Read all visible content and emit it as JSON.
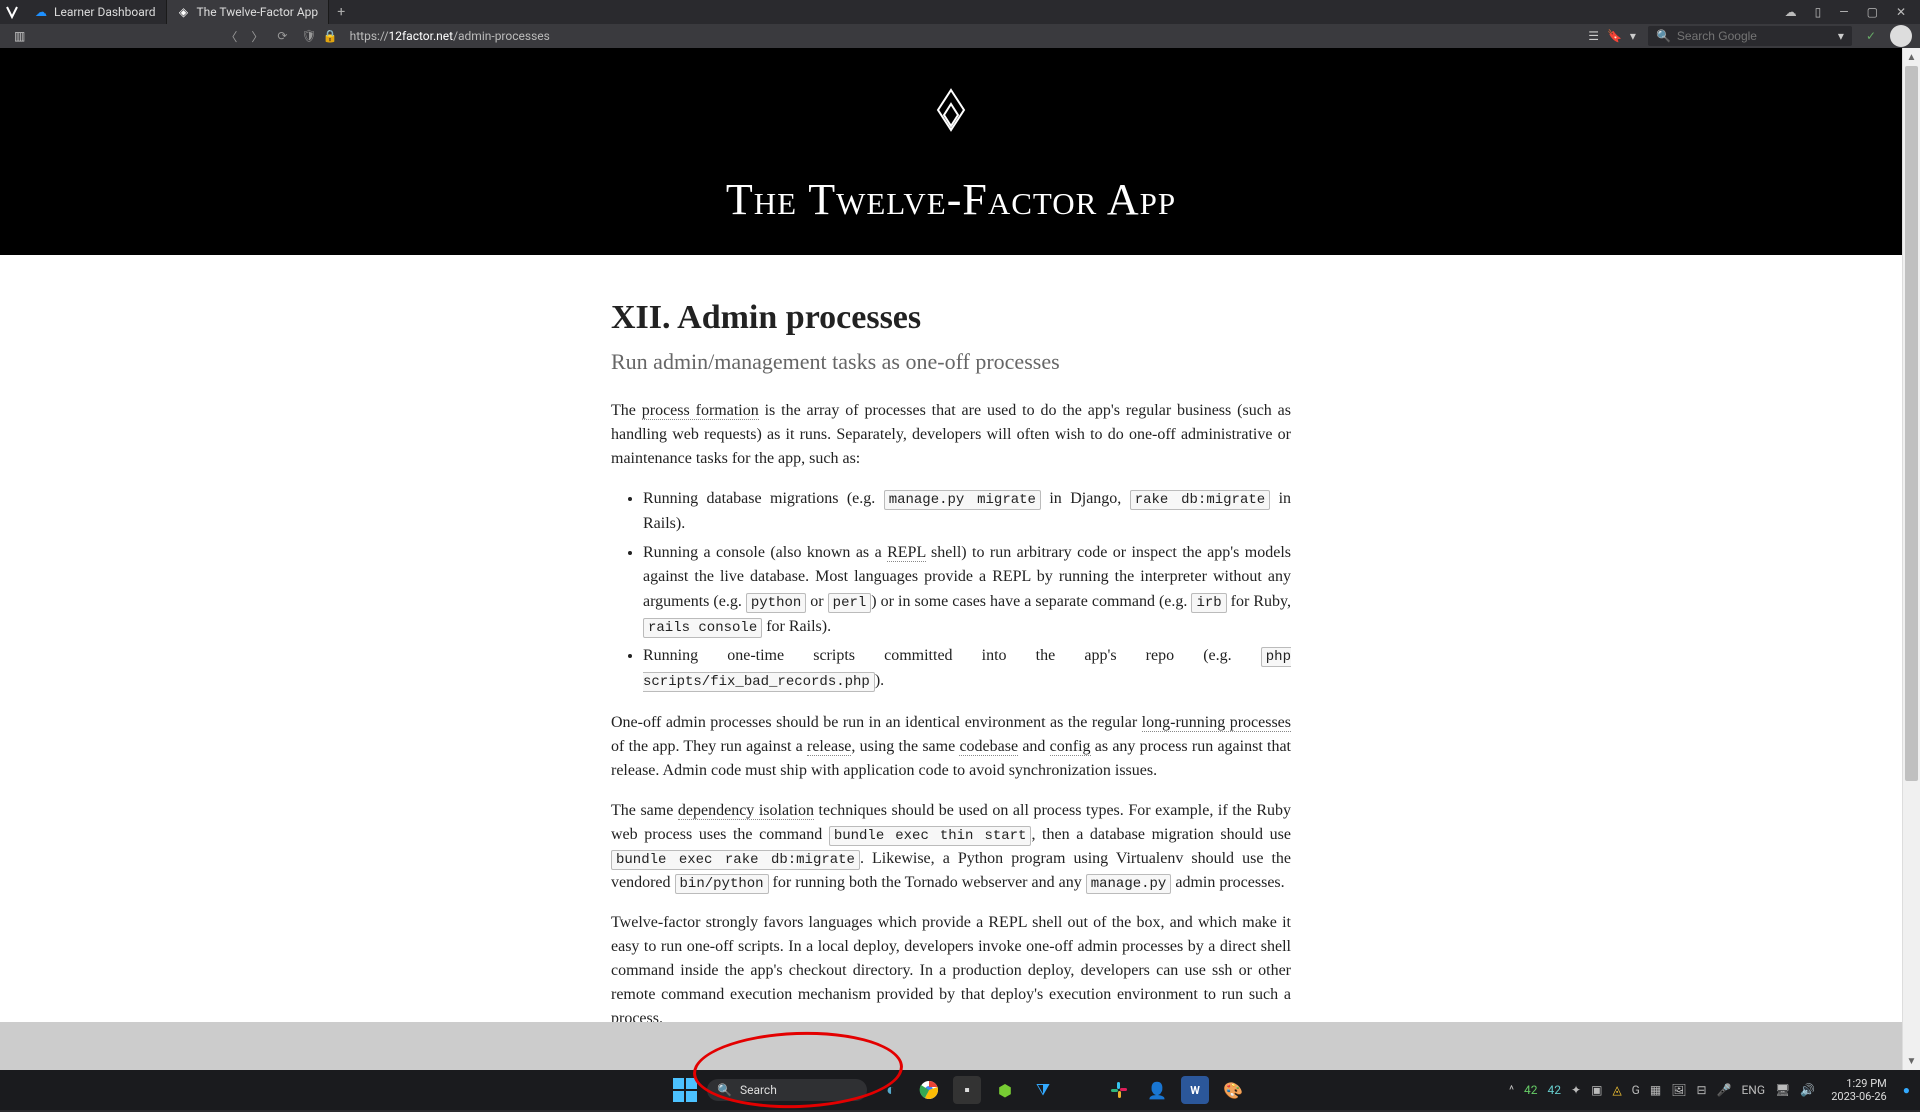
{
  "browser": {
    "tabs": [
      {
        "label": "Learner Dashboard",
        "active": false,
        "favicon": "blue"
      },
      {
        "label": "The Twelve-Factor App",
        "active": true,
        "favicon": "diamond"
      }
    ],
    "url_prefix": "https://",
    "url_domain": "12factor.net",
    "url_path": "/admin-processes",
    "search_placeholder": "Search Google"
  },
  "page": {
    "site_title": "The Twelve-Factor App",
    "heading": "XII. Admin processes",
    "subtitle": "Run admin/management tasks as one-off processes",
    "p1_a": "The ",
    "p1_link1": "process formation",
    "p1_b": " is the array of processes that are used to do the app's regular business (such as handling web requests) as it runs. Separately, developers will often wish to do one-off administrative or maintenance tasks for the app, such as:",
    "li1_a": "Running database migrations (e.g. ",
    "li1_code1": "manage.py migrate",
    "li1_b": " in Django, ",
    "li1_code2": "rake db:migrate",
    "li1_c": " in Rails).",
    "li2_a": "Running a console (also known as a ",
    "li2_link1": "REPL",
    "li2_b": " shell) to run arbitrary code or inspect the app's models against the live database. Most languages provide a REPL by running the interpreter without any arguments (e.g. ",
    "li2_code1": "python",
    "li2_c": " or ",
    "li2_code2": "perl",
    "li2_d": ") or in some cases have a separate command (e.g. ",
    "li2_code3": "irb",
    "li2_e": " for Ruby, ",
    "li2_code4": "rails console",
    "li2_f": " for Rails).",
    "li3_a": "Running one-time scripts committed into the app's repo (e.g. ",
    "li3_code1": "php scripts/fix_bad_records.php",
    "li3_b": ").",
    "p2_a": "One-off admin processes should be run in an identical environment as the regular ",
    "p2_link1": "long-running processes",
    "p2_b": " of the app. They run against a ",
    "p2_link2": "release",
    "p2_c": ", using the same ",
    "p2_link3": "codebase",
    "p2_d": " and ",
    "p2_link4": "config",
    "p2_e": " as any process run against that release. Admin code must ship with application code to avoid synchronization issues.",
    "p3_a": "The same ",
    "p3_link1": "dependency isolation",
    "p3_b": " techniques should be used on all process types. For example, if the Ruby web process uses the command ",
    "p3_code1": "bundle exec thin start",
    "p3_c": ", then a database migration should use ",
    "p3_code2": "bundle exec rake db:migrate",
    "p3_d": ". Likewise, a Python program using Virtualenv should use the vendored ",
    "p3_code3": "bin/python",
    "p3_e": " for running both the Tornado webserver and any ",
    "p3_code4": "manage.py",
    "p3_f": " admin processes.",
    "p4": "Twelve-factor strongly favors languages which provide a REPL shell out of the box, and which make it easy to run one-off scripts. In a local deploy, developers invoke one-off admin processes by a direct shell command inside the app's checkout directory. In a production deploy, developers can use ssh or other remote command execution mechanism provided by that deploy's execution environment to run such a process."
  },
  "taskbar": {
    "search_label": "Search",
    "weather": "42",
    "lang": "ENG",
    "time": "1:29 PM",
    "date": "2023-06-26"
  }
}
